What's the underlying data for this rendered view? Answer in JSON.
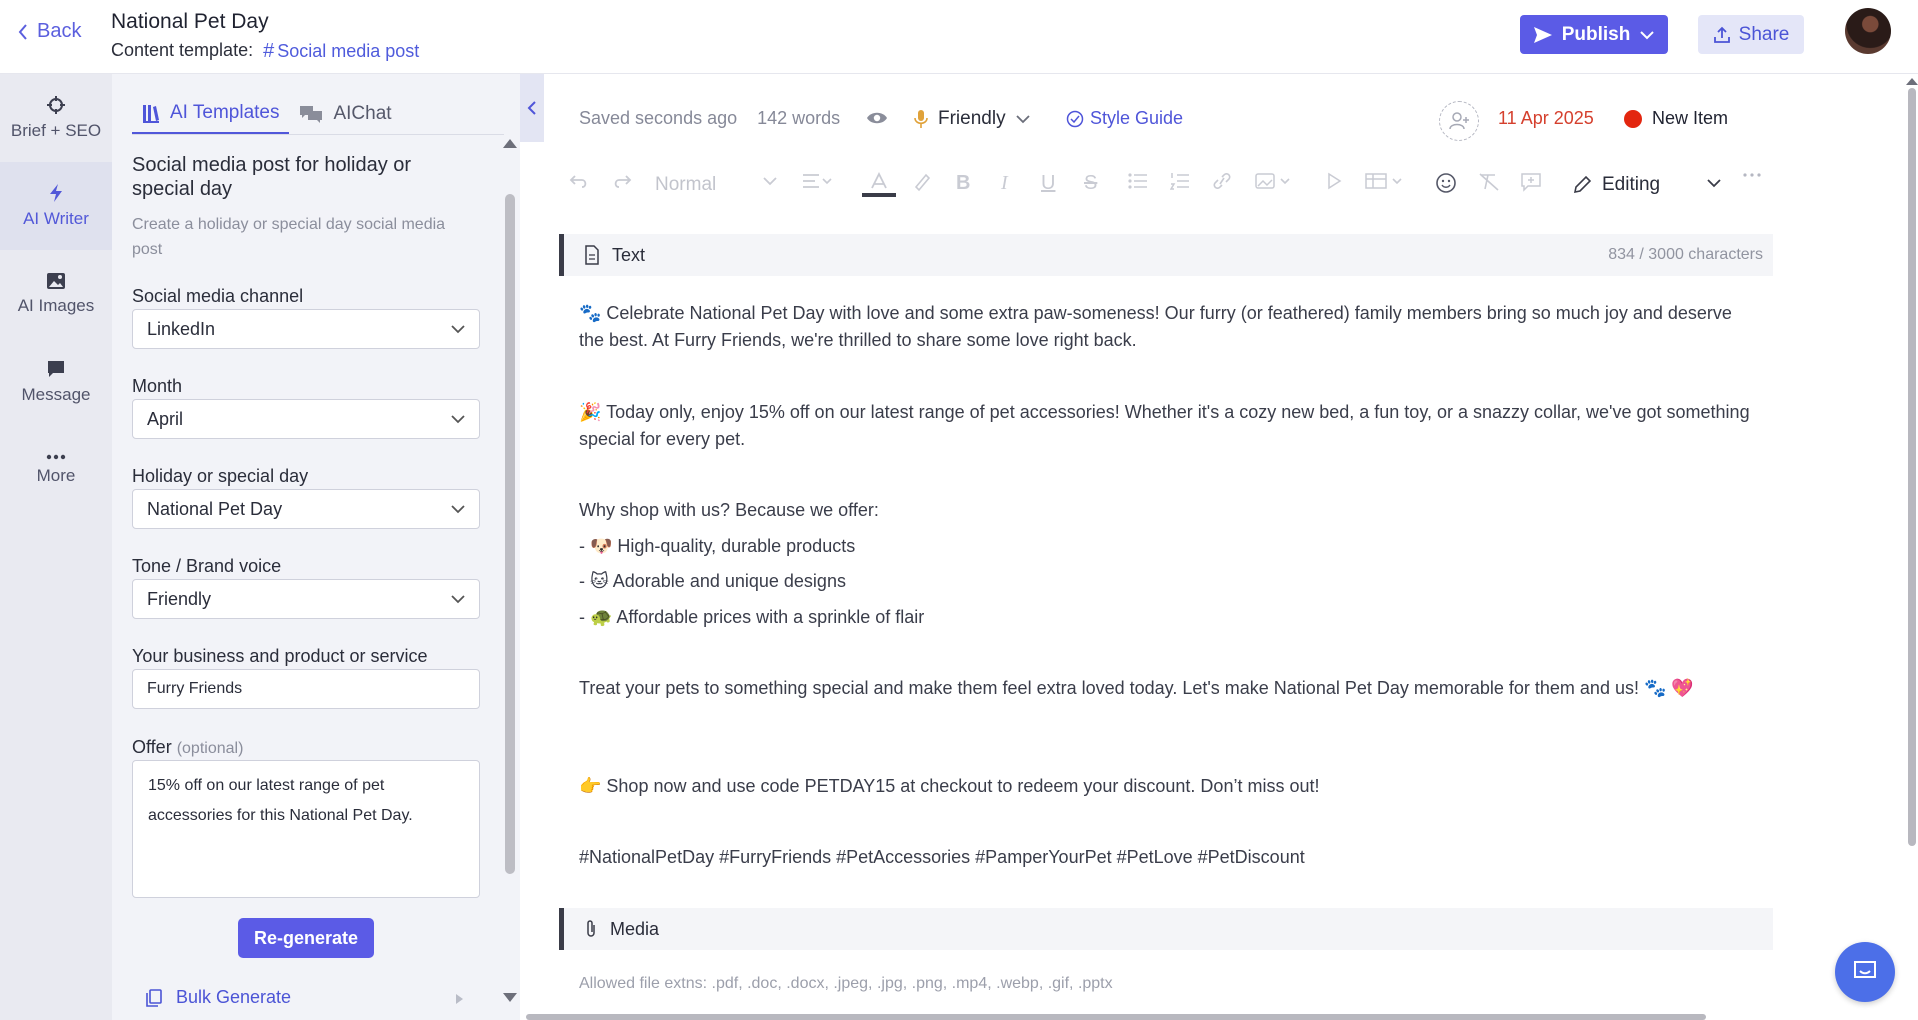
{
  "header": {
    "back_label": "Back",
    "title": "National Pet Day",
    "template_label": "Content template:",
    "template_name": "Social media post",
    "publish_label": "Publish",
    "share_label": "Share"
  },
  "rail": {
    "items": [
      {
        "label": "Brief + SEO",
        "icon": "crosshair-icon"
      },
      {
        "label": "AI Writer",
        "icon": "lightning-icon"
      },
      {
        "label": "AI Images",
        "icon": "image-icon"
      },
      {
        "label": "Message",
        "icon": "message-icon"
      },
      {
        "label": "More",
        "icon": "more-dots-icon"
      }
    ],
    "active": "AI Writer"
  },
  "panel": {
    "tabs": [
      "AI Templates",
      "AIChat"
    ],
    "active_tab": "AI Templates",
    "title": "Social media post for holiday or special day",
    "description": "Create a holiday or special day social media post",
    "fields": {
      "channel": {
        "label": "Social media channel",
        "value": "LinkedIn"
      },
      "month": {
        "label": "Month",
        "value": "April"
      },
      "holiday": {
        "label": "Holiday or special day",
        "value": "National Pet Day"
      },
      "tone": {
        "label": "Tone / Brand voice",
        "value": "Friendly"
      },
      "business": {
        "label": "Your business and product or service",
        "value": "Furry Friends"
      },
      "offer": {
        "label": "Offer",
        "optional": "(optional)",
        "value": "15% off on our latest range of pet accessories for this National Pet Day."
      }
    },
    "regenerate_label": "Re-generate",
    "bulk_label": "Bulk Generate"
  },
  "editor": {
    "saved": "Saved seconds ago",
    "words": "142 words",
    "tone": "Friendly",
    "style_guide": "Style Guide",
    "date": "11 Apr 2025",
    "state": "New Item",
    "toolbar": {
      "paragraph_style": "Normal",
      "mode": "Editing"
    },
    "text_block": {
      "title": "Text",
      "char_count": "834 / 3000 characters",
      "paragraphs": {
        "p1": "🐾 Celebrate National Pet Day with love and some extra paw-someness! Our furry (or feathered) family members bring so much joy and deserve the best. At Furry Friends, we're thrilled to share some love right back.",
        "p2": "🎉 Today only, enjoy 15% off on our latest range of pet accessories! Whether it's a cozy new bed, a fun toy, or a snazzy collar, we've got something special for every pet.",
        "p3": "Why shop with us? Because we offer:",
        "b1": "- 🐶 High-quality, durable products",
        "b2": "- 🐱 Adorable and unique designs",
        "b3": "- 🐢 Affordable prices with a sprinkle of flair",
        "p4": "Treat your pets to something special and make them feel extra loved today. Let's make National Pet Day memorable for them and us! 🐾 💖",
        "p5": "👉 Shop now and use code PETDAY15 at checkout to redeem your discount. Don’t miss out!",
        "p6": "#NationalPetDay #FurryFriends #PetAccessories #PamperYourPet #PetLove #PetDiscount"
      }
    },
    "media_block": {
      "title": "Media",
      "allowed": "Allowed file extns: .pdf, .doc, .docx, .jpeg, .jpg, .png, .mp4, .webp, .gif, .pptx"
    }
  },
  "colors": {
    "accent": "#5b5be6",
    "link": "#4f55d9",
    "date_red": "#d5402e",
    "status_dot": "#e3260f"
  }
}
